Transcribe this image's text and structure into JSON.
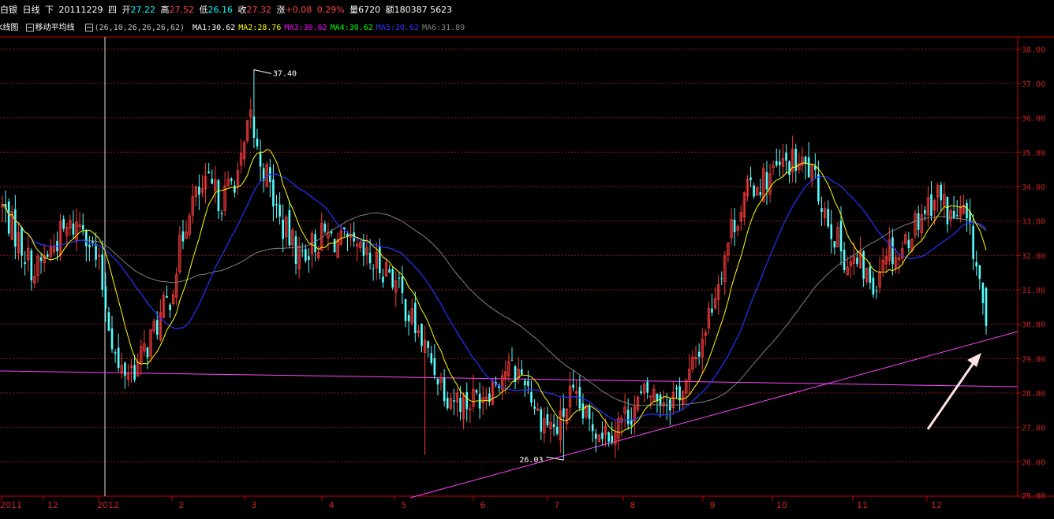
{
  "header": {
    "name": "白银",
    "period": "日线",
    "mode": "下",
    "date": "20111229",
    "weekday": "四",
    "open_label": "开",
    "open": "27.22",
    "high_label": "高",
    "high": "27.52",
    "low_label": "低",
    "low": "26.16",
    "close_label": "收",
    "close": "27.32",
    "change_label": "涨",
    "change": "+0.08",
    "change_pct": "0.29%",
    "volume_label": "量",
    "volume": "6720",
    "amount_label": "额",
    "amount": "180387 5623"
  },
  "indicators": {
    "kline_label": "K线图",
    "ma_label": "移动平均线",
    "params": "(26,10,26,26,26,62)",
    "ma": [
      {
        "name": "MA1",
        "value": "30.62",
        "color": "#ffffff"
      },
      {
        "name": "MA2",
        "value": "28.76",
        "color": "#ffff00"
      },
      {
        "name": "MA3",
        "value": "30.62",
        "color": "#ff00ff"
      },
      {
        "name": "MA4",
        "value": "30.62",
        "color": "#00ff00"
      },
      {
        "name": "MA5",
        "value": "30.62",
        "color": "#3333ff"
      },
      {
        "name": "MA6",
        "value": "31.89",
        "color": "#808080"
      }
    ]
  },
  "colors": {
    "up": "#ff3c3c",
    "down": "#54ffff",
    "grid": "#8b1a1a",
    "axis": "#cc0000",
    "ma_short": "#ffff00",
    "ma_mid": "#2233ff",
    "ma_long": "#808080",
    "trendline": "#ff44ff",
    "arrow": "#ffe4e4"
  },
  "chart_data": {
    "type": "candlestick",
    "ylim": [
      26,
      38
    ],
    "yticks": [
      "38.00",
      "37.00",
      "36.00",
      "35.00",
      "34.00",
      "33.00",
      "32.00",
      "31.00",
      "30.00",
      "29.00",
      "28.00",
      "27.00",
      "26.00",
      "25.00"
    ],
    "x_labels": [
      "2011",
      "12",
      "2012",
      "2",
      "3",
      "4",
      "5",
      "6",
      "7",
      "8",
      "9",
      "10",
      "11",
      "12"
    ],
    "annotations": [
      {
        "text": "37.40",
        "value": 37.4
      },
      {
        "text": "26.03",
        "value": 26.03
      }
    ],
    "lows_ohlc_note": "",
    "anchors": [
      [
        0,
        33.4
      ],
      [
        10,
        31.5
      ],
      [
        18,
        32.6
      ],
      [
        25,
        33.0
      ],
      [
        30,
        31.6
      ],
      [
        36,
        28.6
      ],
      [
        42,
        28.8
      ],
      [
        46,
        29.6
      ],
      [
        52,
        30.8
      ],
      [
        58,
        33.5
      ],
      [
        64,
        34.0
      ],
      [
        68,
        33.6
      ],
      [
        74,
        34.6
      ],
      [
        77,
        36.0
      ],
      [
        79,
        35.0
      ],
      [
        82,
        34.3
      ],
      [
        86,
        33.0
      ],
      [
        92,
        32.0
      ],
      [
        100,
        32.6
      ],
      [
        106,
        32.3
      ],
      [
        114,
        31.8
      ],
      [
        120,
        31.6
      ],
      [
        126,
        30.3
      ],
      [
        132,
        29.1
      ],
      [
        138,
        28.0
      ],
      [
        144,
        27.7
      ],
      [
        150,
        28.1
      ],
      [
        156,
        28.7
      ],
      [
        162,
        28.5
      ],
      [
        166,
        27.4
      ],
      [
        172,
        26.9
      ],
      [
        176,
        27.9
      ],
      [
        182,
        27.1
      ],
      [
        188,
        26.9
      ],
      [
        194,
        27.4
      ],
      [
        200,
        28.0
      ],
      [
        206,
        27.8
      ],
      [
        212,
        28.2
      ],
      [
        216,
        29.3
      ],
      [
        220,
        30.6
      ],
      [
        226,
        32.8
      ],
      [
        232,
        34.0
      ],
      [
        238,
        34.3
      ],
      [
        244,
        34.7
      ],
      [
        250,
        34.5
      ],
      [
        254,
        33.6
      ],
      [
        258,
        32.6
      ],
      [
        262,
        31.8
      ],
      [
        266,
        31.7
      ],
      [
        270,
        31.1
      ],
      [
        274,
        32.3
      ],
      [
        278,
        32.0
      ],
      [
        282,
        32.8
      ],
      [
        286,
        33.4
      ],
      [
        290,
        33.8
      ],
      [
        294,
        33.1
      ],
      [
        298,
        33.2
      ],
      [
        301,
        32.2
      ],
      [
        303,
        31.2
      ],
      [
        305,
        29.8
      ]
    ]
  }
}
